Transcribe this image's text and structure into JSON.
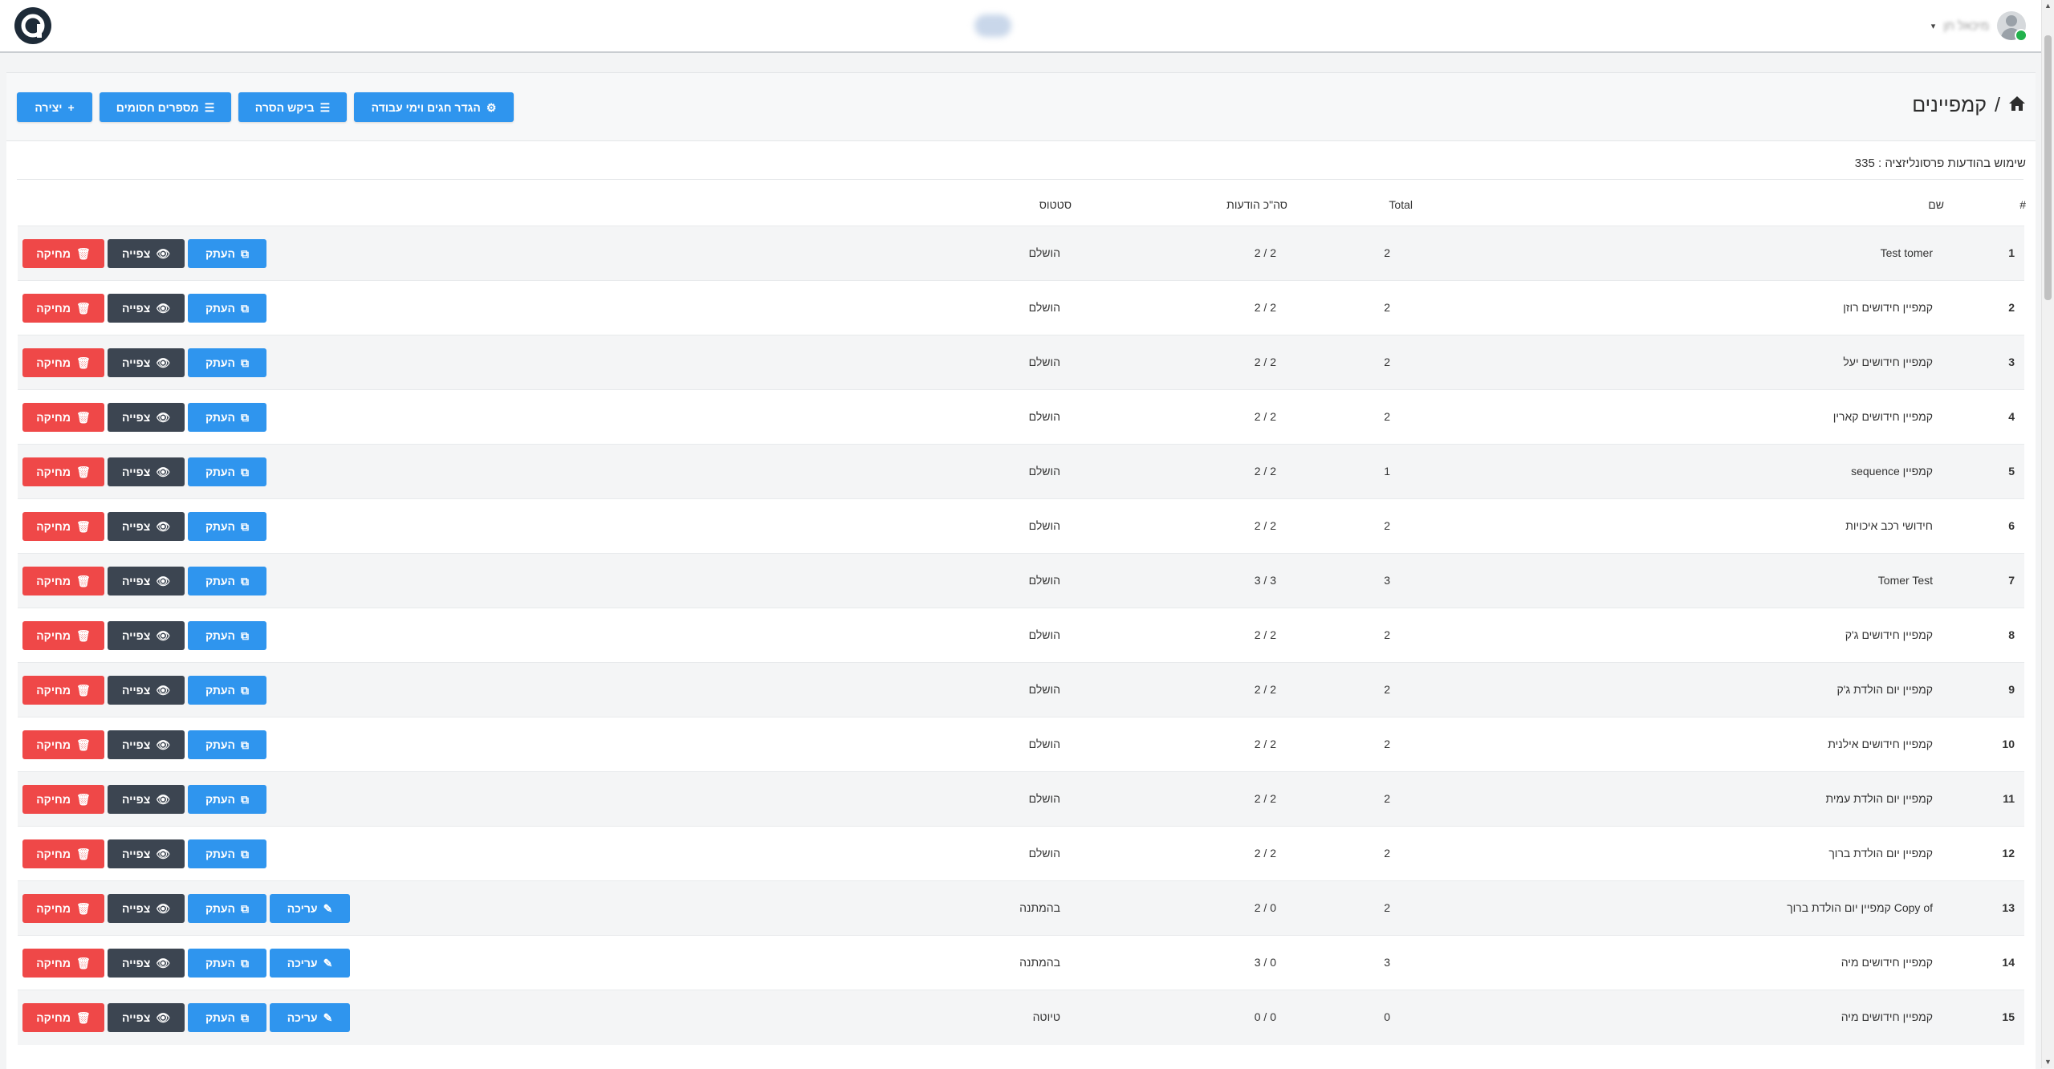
{
  "header": {
    "user_name": "מיכאל חן",
    "caret": "▾"
  },
  "page": {
    "title": "קמפיינים",
    "breadcrumb_sep": "/",
    "personalization_stat": "שימוש בהודעות פרסונליזציה : 335"
  },
  "toolbar": {
    "create_label": "יצירה",
    "blocked_label": "מספרים חסומים",
    "removal_label": "ביקש הסרה",
    "holidays_label": "הגדר חגים וימי עבודה"
  },
  "table": {
    "headers": {
      "index": "#",
      "name": "שם",
      "total": "Total",
      "messages": "סה\"כ הודעות",
      "status": "סטטוס"
    },
    "actions": {
      "edit": "עריכה",
      "copy": "העתק",
      "view": "צפייה",
      "delete": "מחיקה"
    },
    "rows": [
      {
        "index": "1",
        "name": "Test tomer",
        "total": "2",
        "messages": "2 / 2",
        "status": "הושלם"
      },
      {
        "index": "2",
        "name": "קמפיין חידושים רוזן",
        "total": "2",
        "messages": "2 / 2",
        "status": "הושלם"
      },
      {
        "index": "3",
        "name": "קמפיין חידושים יעל",
        "total": "2",
        "messages": "2 / 2",
        "status": "הושלם"
      },
      {
        "index": "4",
        "name": "קמפיין חידושים קארין",
        "total": "2",
        "messages": "2 / 2",
        "status": "הושלם"
      },
      {
        "index": "5",
        "name": "קמפיין sequence",
        "total": "1",
        "messages": "2 / 2",
        "status": "הושלם"
      },
      {
        "index": "6",
        "name": "חידושי רכב איכויות",
        "total": "2",
        "messages": "2 / 2",
        "status": "הושלם"
      },
      {
        "index": "7",
        "name": "Tomer Test",
        "total": "3",
        "messages": "3 / 3",
        "status": "הושלם"
      },
      {
        "index": "8",
        "name": "קמפיין חידושים ג'ק",
        "total": "2",
        "messages": "2 / 2",
        "status": "הושלם"
      },
      {
        "index": "9",
        "name": "קמפיין יום הולדת ג'ק",
        "total": "2",
        "messages": "2 / 2",
        "status": "הושלם"
      },
      {
        "index": "10",
        "name": "קמפיין חידושים אילנית",
        "total": "2",
        "messages": "2 / 2",
        "status": "הושלם"
      },
      {
        "index": "11",
        "name": "קמפיין יום הולדת עמית",
        "total": "2",
        "messages": "2 / 2",
        "status": "הושלם"
      },
      {
        "index": "12",
        "name": "קמפיין יום הולדת ברוך",
        "total": "2",
        "messages": "2 / 2",
        "status": "הושלם"
      },
      {
        "index": "13",
        "name": "Copy of קמפיין יום הולדת ברוך",
        "total": "2",
        "messages": "2 / 0",
        "status": "בהמתנה"
      },
      {
        "index": "14",
        "name": "קמפיין חידושים מיה",
        "total": "3",
        "messages": "3 / 0",
        "status": "בהמתנה"
      },
      {
        "index": "15",
        "name": "קמפיין חידושים מיה",
        "total": "0",
        "messages": "0 / 0",
        "status": "טיוטה"
      }
    ]
  },
  "colors": {
    "blue": "#2f95ee",
    "dark": "#3c4551",
    "red": "#ef4848",
    "navy": "#1e2b38"
  },
  "icons": {
    "home": "home-icon",
    "plus": "plus-icon",
    "list": "list-icon",
    "gear": "gear-icon",
    "copy": "copy-icon",
    "eye": "eye-icon",
    "trash": "trash-icon",
    "pencil": "pencil-icon"
  }
}
